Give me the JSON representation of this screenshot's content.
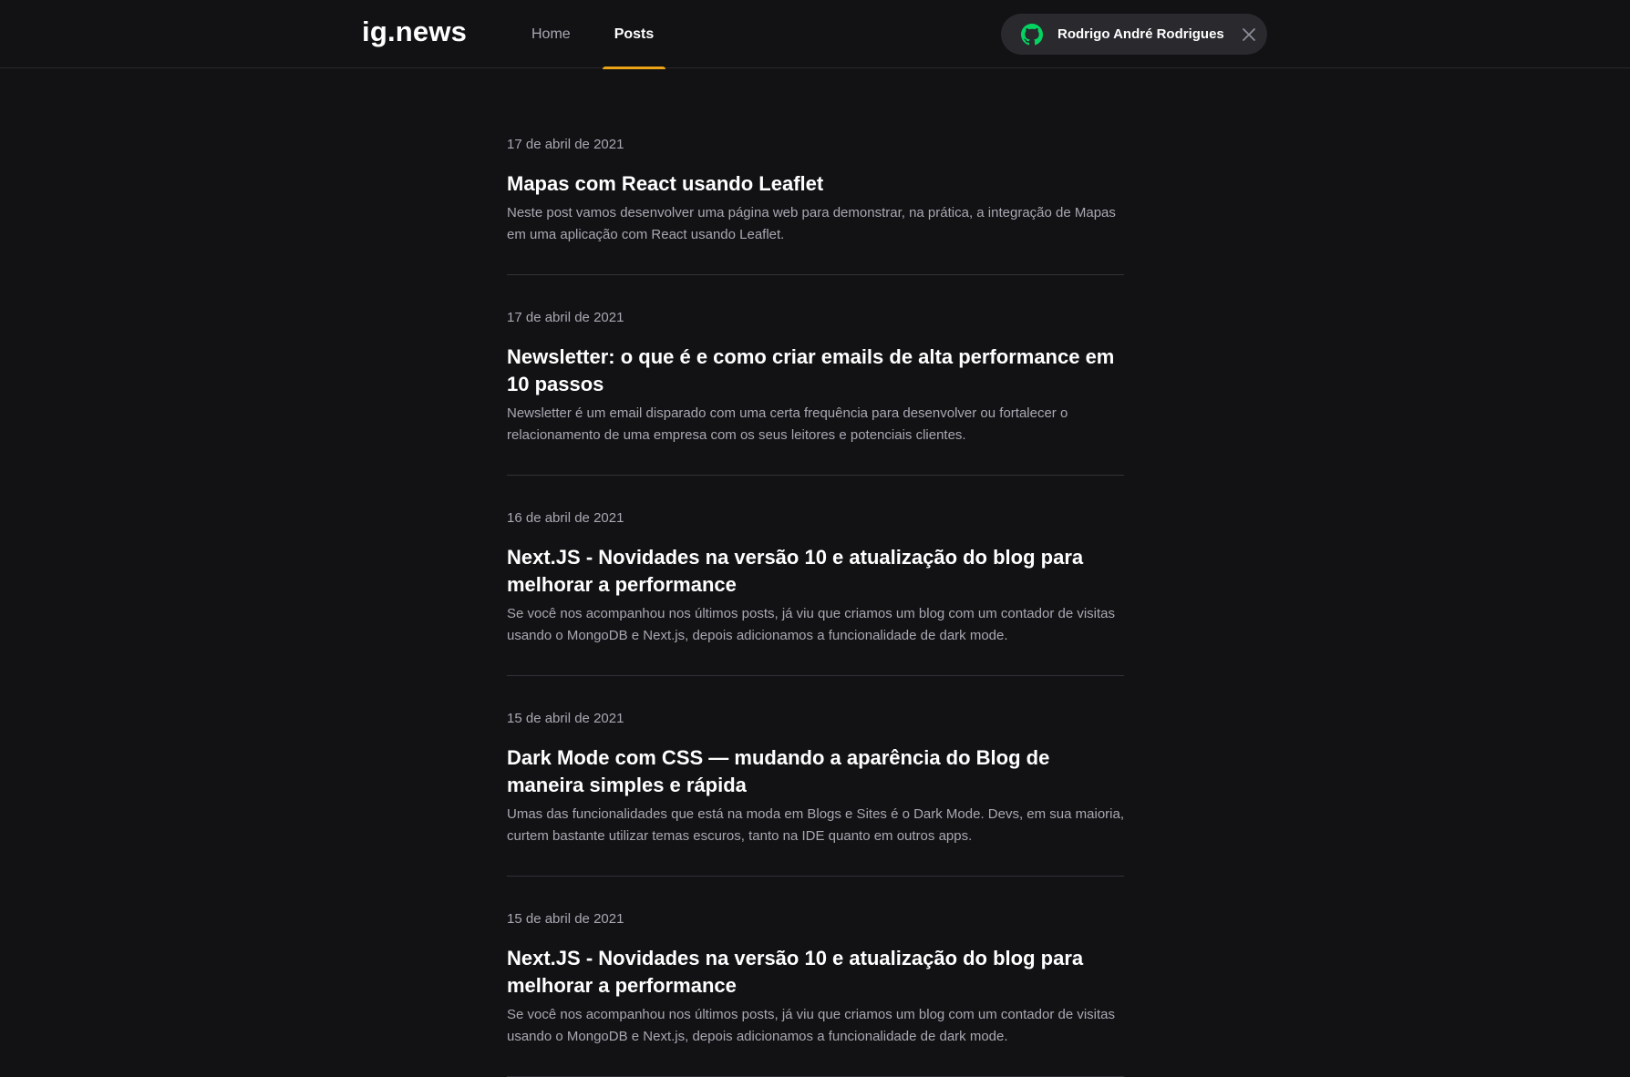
{
  "header": {
    "logo": "ig.news",
    "nav": [
      {
        "label": "Home",
        "active": false
      },
      {
        "label": "Posts",
        "active": true
      }
    ],
    "user": {
      "name": "Rodrigo André Rodrigues",
      "icon": "github-icon",
      "close_icon": "close-icon"
    }
  },
  "colors": {
    "background": "#121214",
    "accent": "#eba417",
    "github_green": "#04d361",
    "text_muted": "#a8a8b3"
  },
  "posts": [
    {
      "date": "17 de abril de 2021",
      "title": "Mapas com React usando Leaflet",
      "excerpt": "Neste post vamos desenvolver uma página web para demonstrar, na prática, a integração de Mapas em uma aplicação com React usando Leaflet."
    },
    {
      "date": "17 de abril de 2021",
      "title": "Newsletter: o que é e como criar emails de alta performance em 10 passos",
      "excerpt": "Newsletter é um email disparado com uma certa frequência para desenvolver ou fortalecer o relacionamento de uma empresa com os seus leitores e potenciais clientes."
    },
    {
      "date": "16 de abril de 2021",
      "title": "Next.JS - Novidades na versão 10 e atualização do blog para melhorar a performance",
      "excerpt": "Se você nos acompanhou nos últimos posts, já viu que criamos um blog com um contador de visitas usando o MongoDB e Next.js, depois adicionamos a funcionalidade de dark mode."
    },
    {
      "date": "15 de abril de 2021",
      "title": "Dark Mode com CSS — mudando a aparência do Blog de maneira simples e rápida",
      "excerpt": "Umas das funcionalidades que está na moda em Blogs e Sites é o Dark Mode. Devs, em sua maioria, curtem bastante utilizar temas escuros, tanto na IDE quanto em outros apps."
    },
    {
      "date": "15 de abril de 2021",
      "title": "Next.JS - Novidades na versão 10 e atualização do blog para melhorar a performance",
      "excerpt": "Se você nos acompanhou nos últimos posts, já viu que criamos um blog com um contador de visitas usando o MongoDB e Next.js, depois adicionamos a funcionalidade de dark mode."
    }
  ]
}
